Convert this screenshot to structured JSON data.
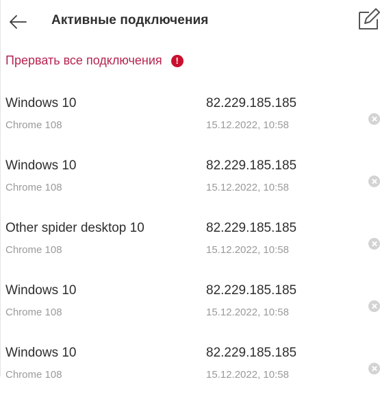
{
  "header": {
    "title": "Активные подключения",
    "back_icon": "arrow-left-icon",
    "edit_icon": "edit-icon"
  },
  "actions": {
    "terminate_all_label": "Прервать все подключения",
    "warning_icon": "exclamation-circle-icon",
    "warning_glyph": "!"
  },
  "colors": {
    "accent": "#b5244f",
    "warning": "#c8102e",
    "primary_text": "#2e2e2e",
    "secondary_text": "#9a9a9a",
    "close_icon": "#d3d3d3"
  },
  "sessions": [
    {
      "device": "Windows 10",
      "browser": "Chrome 108",
      "ip": "82.229.185.185",
      "datetime": "15.12.2022, 10:58"
    },
    {
      "device": "Windows 10",
      "browser": "Chrome 108",
      "ip": "82.229.185.185",
      "datetime": "15.12.2022, 10:58"
    },
    {
      "device": "Other spider desktop 10",
      "browser": "Chrome 108",
      "ip": "82.229.185.185",
      "datetime": "15.12.2022, 10:58"
    },
    {
      "device": "Windows 10",
      "browser": "Chrome 108",
      "ip": "82.229.185.185",
      "datetime": "15.12.2022, 10:58"
    },
    {
      "device": "Windows 10",
      "browser": "Chrome 108",
      "ip": "82.229.185.185",
      "datetime": "15.12.2022, 10:58"
    }
  ]
}
